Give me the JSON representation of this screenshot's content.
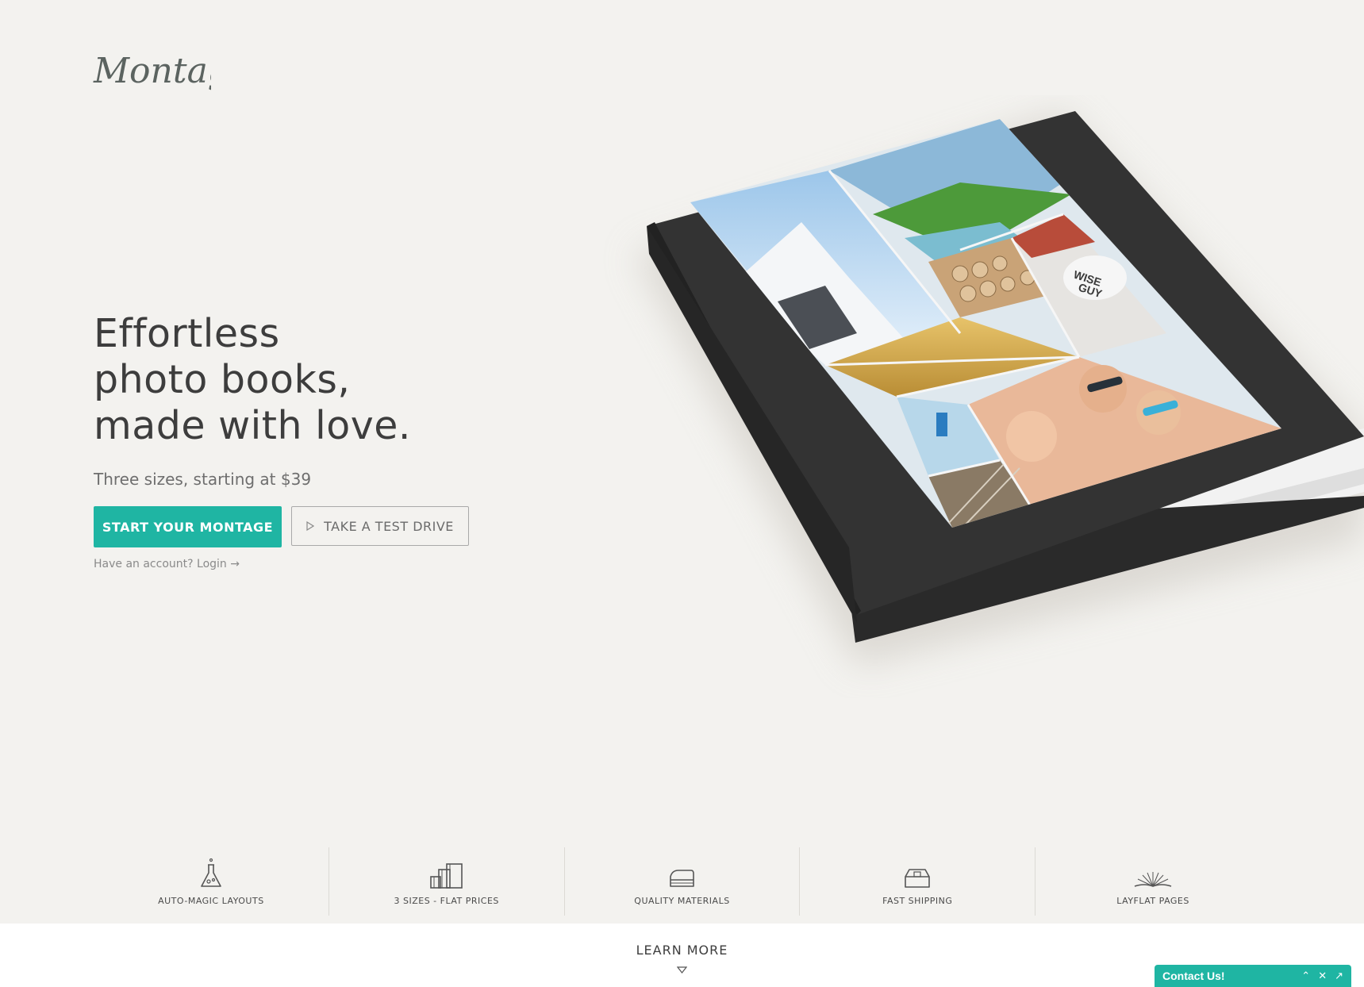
{
  "brand": {
    "logo_text": "Montage"
  },
  "hero": {
    "headline_lines": [
      "Effortless",
      "photo books,",
      "made with love."
    ],
    "subtitle": "Three sizes, starting at $39",
    "primary_cta": "START YOUR MONTAGE",
    "secondary_cta": "TAKE A TEST DRIVE",
    "login_text": "Have an account? Login →"
  },
  "product_image": {
    "cover_text_1": "WISE",
    "cover_text_2": "GUY"
  },
  "features": [
    {
      "label": "AUTO-MAGIC LAYOUTS",
      "icon": "flask-icon"
    },
    {
      "label": "3 SIZES - FLAT PRICES",
      "icon": "book-sizes-icon"
    },
    {
      "label": "QUALITY MATERIALS",
      "icon": "book-stack-icon"
    },
    {
      "label": "FAST SHIPPING",
      "icon": "shipping-box-icon"
    },
    {
      "label": "LAYFLAT PAGES",
      "icon": "open-book-icon"
    }
  ],
  "learn_more": "LEARN MORE",
  "contact_widget": {
    "label": "Contact Us!"
  },
  "colors": {
    "accent": "#1fb5a3",
    "background": "#f3f2ef"
  }
}
